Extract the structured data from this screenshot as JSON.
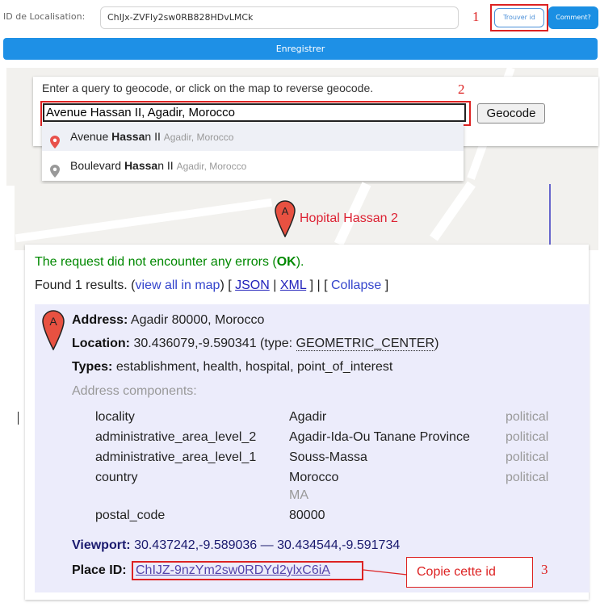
{
  "form": {
    "id_label": "ID de Localisation:",
    "id_value": "ChIJx-ZVFly2sw0RB828HDvLMCk",
    "trouver_label": "Trouver id",
    "comment_label": "Comment?",
    "enregistrer_label": "Enregistrer"
  },
  "geocoder": {
    "hint": "Enter a query to geocode, or click on the map to reverse geocode.",
    "query": "Avenue Hassan II, Agadir, Morocco",
    "button": "Geocode",
    "suggestions": [
      {
        "pre": "Avenue ",
        "bold": "Hassa",
        "post": "n II",
        "secondary": "Agadir, Morocco"
      },
      {
        "pre": "Boulevard ",
        "bold": "Hassa",
        "post": "n II",
        "secondary": "Agadir, Morocco"
      }
    ]
  },
  "map": {
    "marker_label": "Hopital Hassan 2"
  },
  "result": {
    "status_pre": "The request did not encounter any errors (",
    "status_code": "OK",
    "status_post": ").",
    "found_text": "Found 1 results.",
    "view_all": "view all in map",
    "json": "JSON",
    "xml": "XML",
    "collapse": "Collapse",
    "address_label": "Address:",
    "address_value": "Agadir 80000, Morocco",
    "location_label": "Location:",
    "location_value": "30.436079,-9.590341 (type: ",
    "location_type": "GEOMETRIC_CENTER",
    "location_close": ")",
    "types_label": "Types:",
    "types_value": "establishment, health, hospital, point_of_interest",
    "components_label": "Address components:",
    "components": [
      {
        "name": "locality",
        "value": "Agadir",
        "type": "political"
      },
      {
        "name": "administrative_area_level_2",
        "value": "Agadir-Ida-Ou Tanane Province",
        "type": "political"
      },
      {
        "name": "administrative_area_level_1",
        "value": "Souss-Massa",
        "type": "political"
      },
      {
        "name": "country",
        "value": "Morocco",
        "value2": "MA",
        "type": "political"
      },
      {
        "name": "postal_code",
        "value": "80000",
        "type": ""
      }
    ],
    "viewport_label": "Viewport:",
    "viewport_value": "30.437242,-9.589036 — 30.434544,-9.591734",
    "place_id_label": "Place ID:",
    "place_id_value": "ChIJZ-9nzYm2sw0RDYd2ylxC6iA"
  },
  "annotations": {
    "n1": "1",
    "n2": "2",
    "n3": "3",
    "copy_note": "Copie cette id",
    "color": "#dd2222"
  }
}
